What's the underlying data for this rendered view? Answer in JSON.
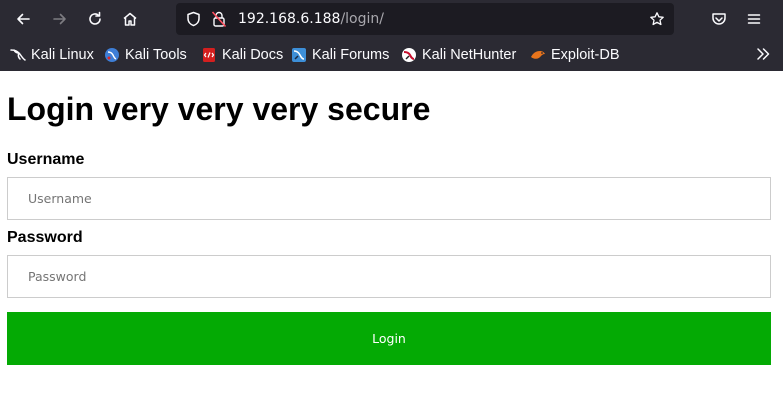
{
  "browser": {
    "url_host": "192.168.6.188",
    "url_path": "/login/",
    "bookmarks": [
      {
        "label": "Kali Linux",
        "icon": "kali-dragon-icon"
      },
      {
        "label": "Kali Tools",
        "icon": "kali-tools-icon"
      },
      {
        "label": "Kali Docs",
        "icon": "kali-docs-icon"
      },
      {
        "label": "Kali Forums",
        "icon": "kali-forums-icon"
      },
      {
        "label": "Kali NetHunter",
        "icon": "kali-nethunter-icon"
      },
      {
        "label": "Exploit-DB",
        "icon": "exploit-db-icon"
      }
    ],
    "colors": {
      "chrome": "#2b2a33",
      "urlbar": "#1c1b22"
    }
  },
  "page": {
    "title": "Login very very very secure",
    "username_label": "Username",
    "username_placeholder": "Username",
    "password_label": "Password",
    "password_placeholder": "Password",
    "login_label": "Login",
    "colors": {
      "button": "#04aa04"
    }
  }
}
